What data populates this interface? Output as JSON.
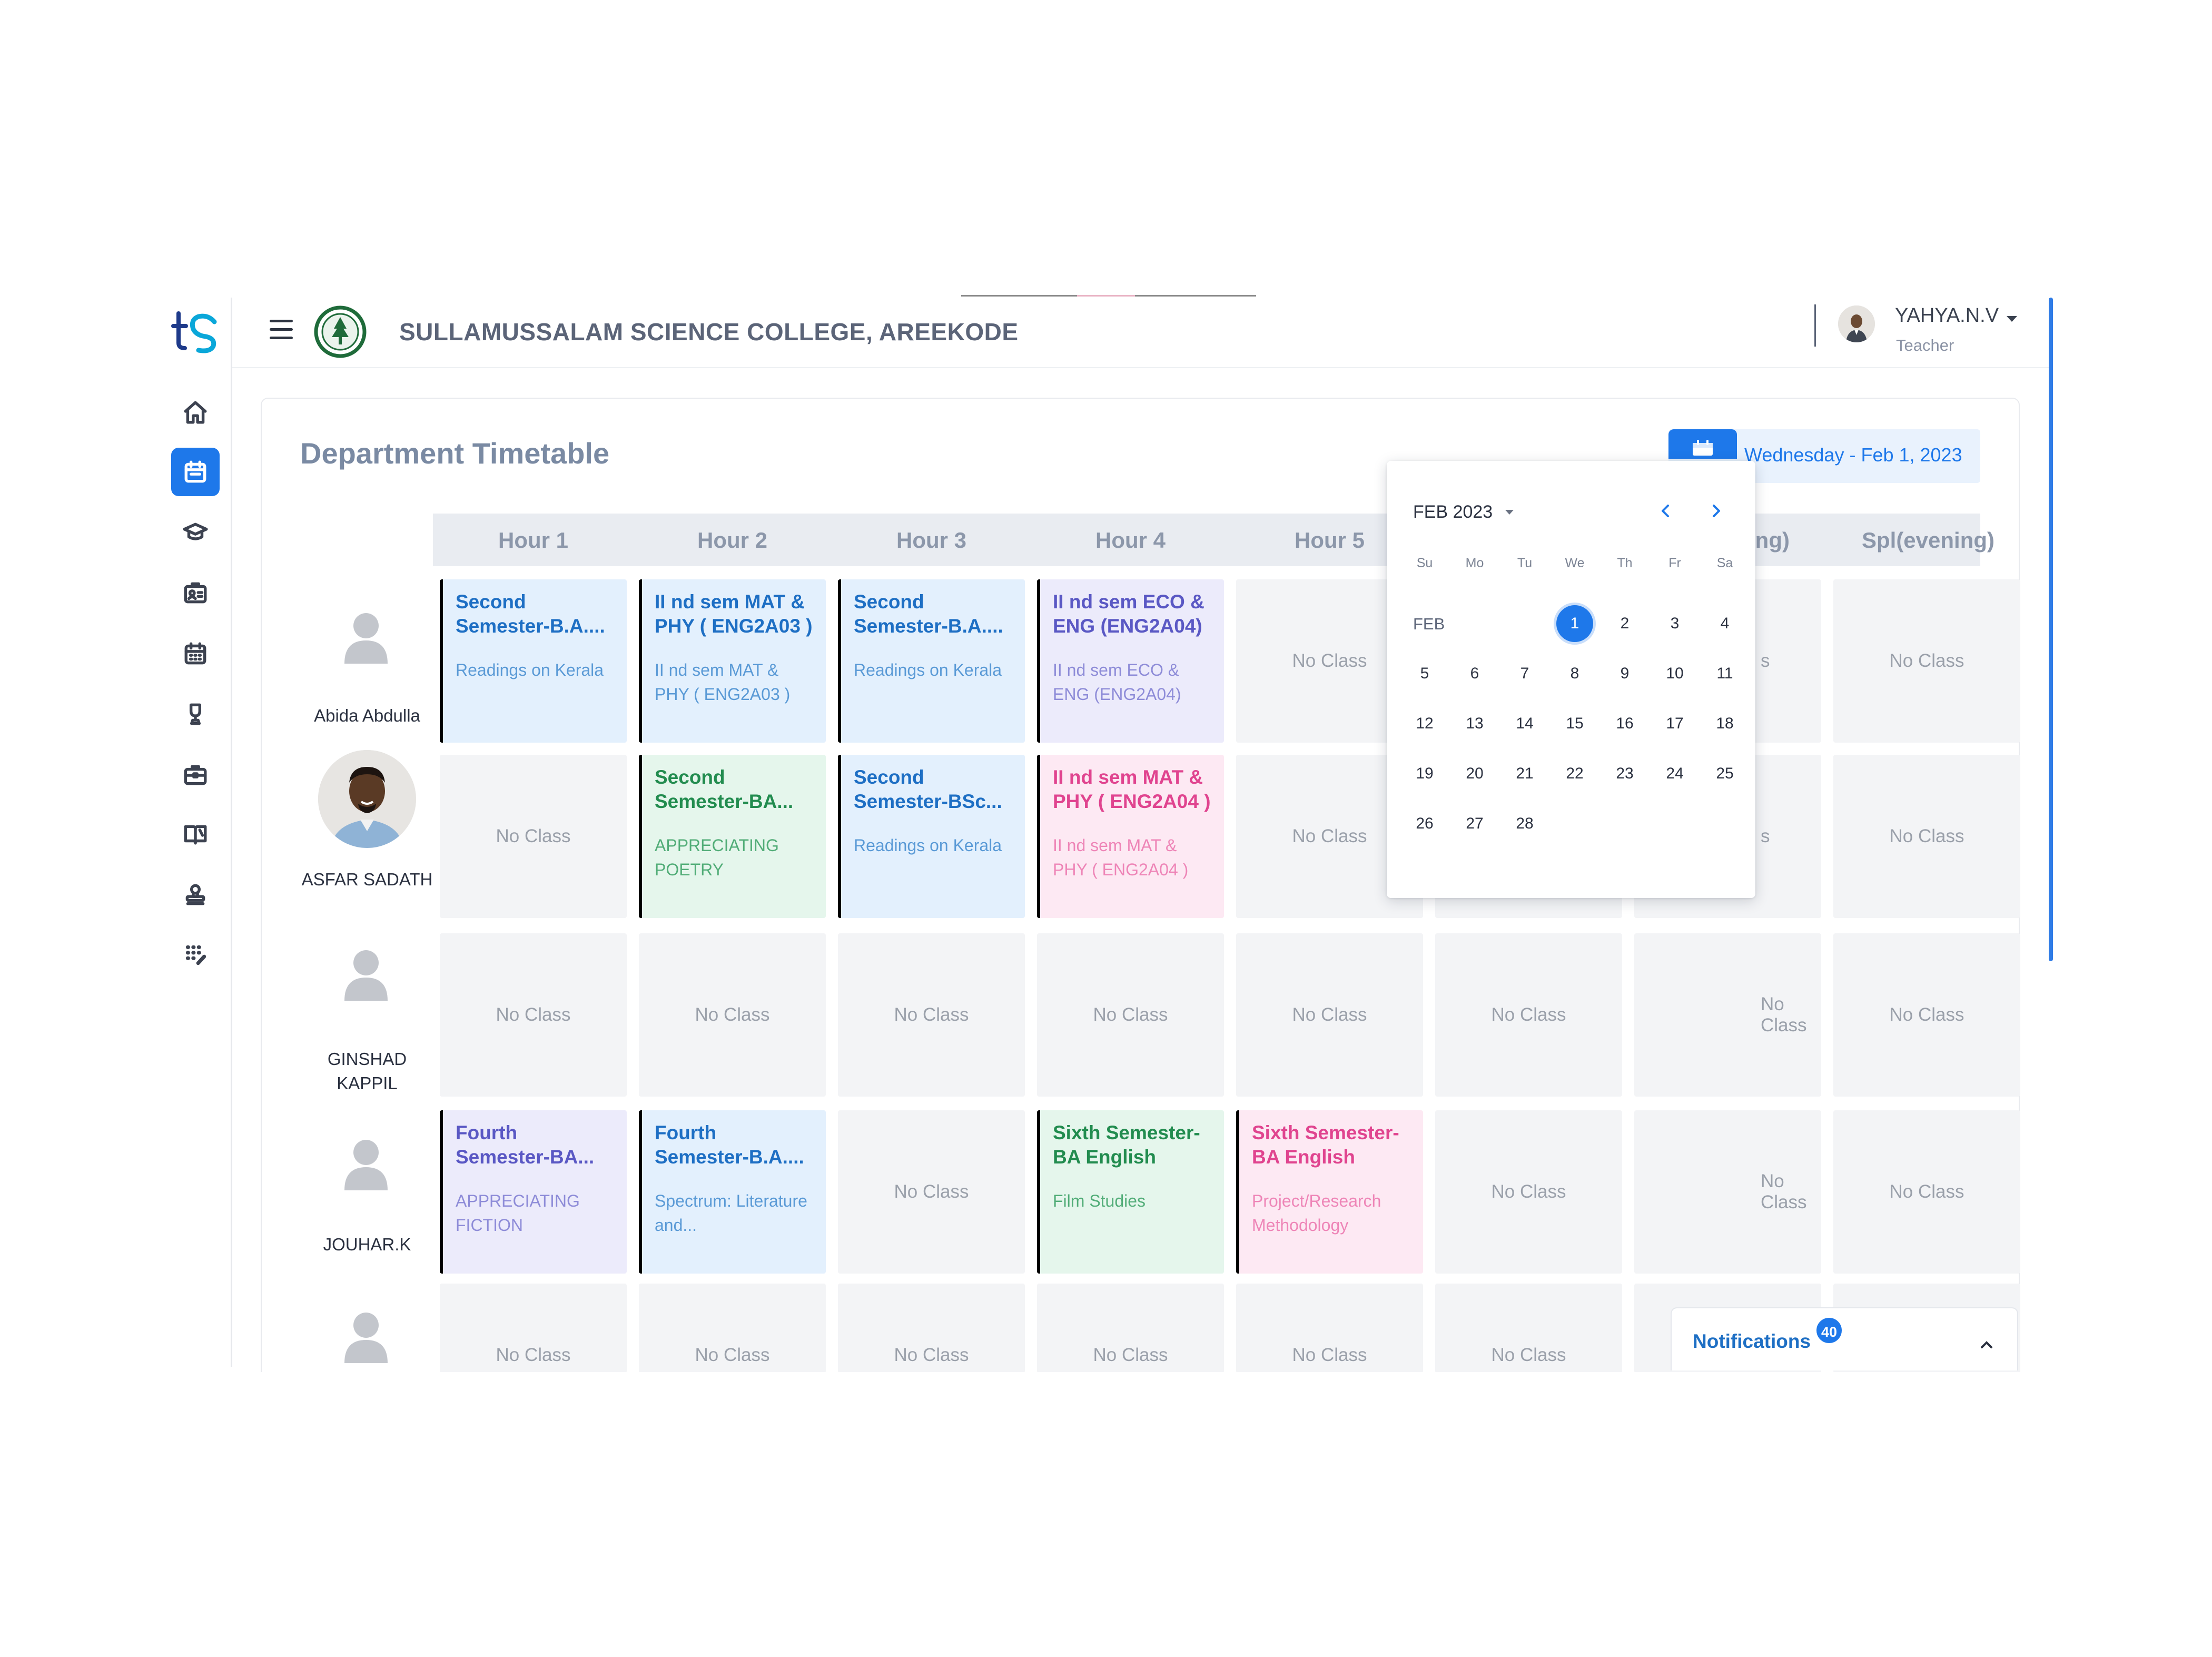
{
  "header": {
    "college_name": "SULLAMUSSALAM SCIENCE COLLEGE, AREEKODE",
    "user_name": "YAHYA.N.V",
    "user_role": "Teacher"
  },
  "sidebar": {
    "items": [
      {
        "icon": "home-icon",
        "active": false
      },
      {
        "icon": "calendar-icon",
        "active": true
      },
      {
        "icon": "graduation-cap-icon",
        "active": false
      },
      {
        "icon": "id-card-icon",
        "active": false
      },
      {
        "icon": "calendar-grid-icon",
        "active": false
      },
      {
        "icon": "trophy-icon",
        "active": false
      },
      {
        "icon": "briefcase-icon",
        "active": false
      },
      {
        "icon": "book-icon",
        "active": false
      },
      {
        "icon": "stamp-icon",
        "active": false
      },
      {
        "icon": "apps-grid-icon",
        "active": false
      }
    ]
  },
  "page": {
    "title": "Department Timetable",
    "date_label": "Wednesday - Feb 1, 2023"
  },
  "hours": [
    "Hour 1",
    "Hour 2",
    "Hour 3",
    "Hour 4",
    "Hour 5",
    "",
    "ing)",
    "Spl(evening)"
  ],
  "timetable": [
    {
      "teacher": "Abida Abdulla",
      "cells": [
        {
          "title": "Second Semester-B.A....",
          "subject": "Readings on Kerala",
          "color": "blue"
        },
        {
          "title": "II nd sem MAT & PHY ( ENG2A03 )",
          "subject": "II nd sem MAT & PHY ( ENG2A03 )",
          "color": "blue"
        },
        {
          "title": "Second Semester-B.A....",
          "subject": "Readings on Kerala",
          "color": "blue"
        },
        {
          "title": "II nd sem ECO & ENG (ENG2A04)",
          "subject": "II nd sem ECO & ENG (ENG2A04)",
          "color": "purple"
        },
        {
          "empty": "No Class"
        },
        {
          "empty": ""
        },
        {
          "empty": "s"
        },
        {
          "empty": "No Class"
        }
      ]
    },
    {
      "teacher": "ASFAR SADATH",
      "cells": [
        {
          "empty": "No Class"
        },
        {
          "title": "Second Semester-BA...",
          "subject": "APPRECIATING POETRY",
          "color": "green"
        },
        {
          "title": "Second Semester-BSc...",
          "subject": "Readings on Kerala",
          "color": "blue"
        },
        {
          "title": "II nd sem MAT & PHY ( ENG2A04 )",
          "subject": "II nd sem MAT & PHY ( ENG2A04 )",
          "color": "pink"
        },
        {
          "empty": "No Class"
        },
        {
          "empty": ""
        },
        {
          "empty": "s"
        },
        {
          "empty": "No Class"
        }
      ]
    },
    {
      "teacher": "GINSHAD KAPPIL",
      "cells": [
        {
          "empty": "No Class"
        },
        {
          "empty": "No Class"
        },
        {
          "empty": "No Class"
        },
        {
          "empty": "No Class"
        },
        {
          "empty": "No Class"
        },
        {
          "empty": "No Class"
        },
        {
          "empty": "No Class"
        },
        {
          "empty": "No Class"
        }
      ]
    },
    {
      "teacher": "JOUHAR.K",
      "cells": [
        {
          "title": "Fourth Semester-BA...",
          "subject": "APPRECIATING FICTION",
          "color": "purple"
        },
        {
          "title": "Fourth Semester-B.A....",
          "subject": "Spectrum: Literature and...",
          "color": "blue"
        },
        {
          "empty": "No Class"
        },
        {
          "title": "Sixth Semester-BA English",
          "subject": "Film Studies",
          "color": "green"
        },
        {
          "title": "Sixth Semester-BA English",
          "subject": "Project/Research Methodology",
          "color": "pink"
        },
        {
          "empty": "No Class"
        },
        {
          "empty": "No Class"
        },
        {
          "empty": "No Class"
        }
      ]
    },
    {
      "teacher": "",
      "cells": [
        {
          "empty": "No Class"
        },
        {
          "empty": "No Class"
        },
        {
          "empty": "No Class"
        },
        {
          "empty": "No Class"
        },
        {
          "empty": "No Class"
        },
        {
          "empty": "No Class"
        },
        {
          "empty": ""
        },
        {
          "empty": ""
        }
      ]
    }
  ],
  "calendar": {
    "month_label": "FEB 2023",
    "row_label": "FEB",
    "weekdays": [
      "Su",
      "Mo",
      "Tu",
      "We",
      "Th",
      "Fr",
      "Sa"
    ],
    "first_weekday_index": 3,
    "days": [
      "1",
      "2",
      "3",
      "4",
      "5",
      "6",
      "7",
      "8",
      "9",
      "10",
      "11",
      "12",
      "13",
      "14",
      "15",
      "16",
      "17",
      "18",
      "19",
      "20",
      "21",
      "22",
      "23",
      "24",
      "25",
      "26",
      "27",
      "28"
    ],
    "selected_day": "1"
  },
  "notifications": {
    "label": "Notifications",
    "count": "40"
  }
}
